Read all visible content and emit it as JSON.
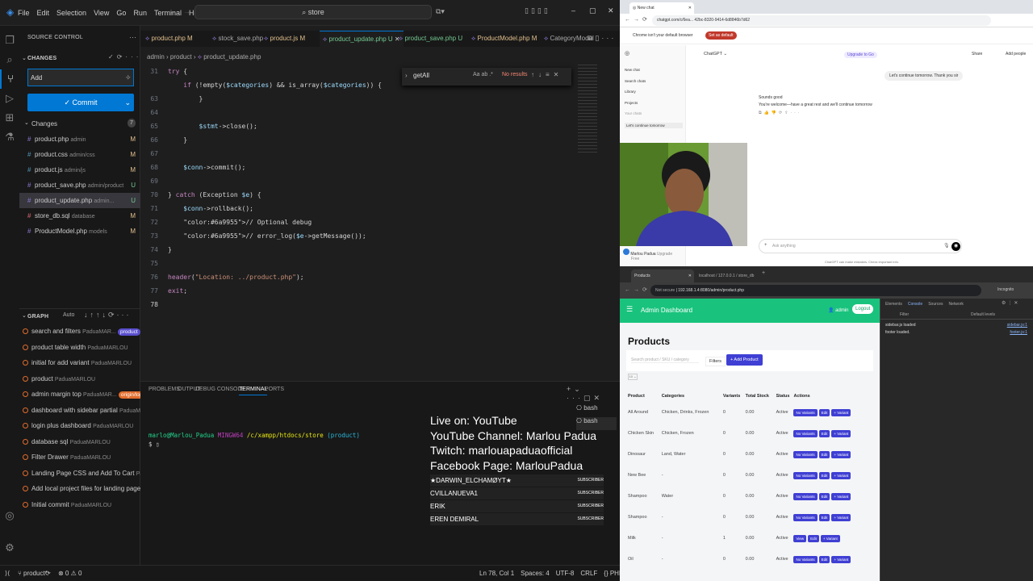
{
  "vscode": {
    "menu": [
      "File",
      "Edit",
      "Selection",
      "View",
      "Go",
      "Run",
      "Terminal",
      "Help"
    ],
    "search_text": "store",
    "source_control_title": "SOURCE CONTROL",
    "changes_header": "CHANGES",
    "commit_input": "Add",
    "commit_button": "✓ Commit",
    "changes_group": "Changes",
    "changes_count": "7",
    "files": [
      {
        "name": "product.php",
        "path": "admin",
        "status": "M"
      },
      {
        "name": "product.css",
        "path": "admin/css",
        "status": "M"
      },
      {
        "name": "product.js",
        "path": "admin/js",
        "status": "M"
      },
      {
        "name": "product_save.php",
        "path": "admin/product",
        "status": "U"
      },
      {
        "name": "product_update.php",
        "path": "admin...",
        "status": "U"
      },
      {
        "name": "store_db.sql",
        "path": "database",
        "status": "M"
      },
      {
        "name": "ProductModel.php",
        "path": "models",
        "status": "M"
      }
    ],
    "graph_header": "GRAPH",
    "graph_auto": "Auto",
    "graph_items": [
      {
        "msg": "search and filters",
        "author": "PaduaMAR...",
        "tag": "product"
      },
      {
        "msg": "product table width",
        "author": "PaduaMARLOU",
        "tag": ""
      },
      {
        "msg": "initial for add variant",
        "author": "PaduaMARLOU",
        "tag": ""
      },
      {
        "msg": "product",
        "author": "PaduaMARLOU",
        "tag": ""
      },
      {
        "msg": "admin margin top",
        "author": "PaduaMAR...",
        "tag": "origin/login"
      },
      {
        "msg": "dashboard with sidebar partial",
        "author": "PaduaMARLOU",
        "tag": ""
      },
      {
        "msg": "login plus dashboard",
        "author": "PaduaMARLOU",
        "tag": ""
      },
      {
        "msg": "database sql",
        "author": "PaduaMARLOU",
        "tag": ""
      },
      {
        "msg": "Filter Drawer",
        "author": "PaduaMARLOU",
        "tag": ""
      },
      {
        "msg": "Landing Page CSS and Add To Cart",
        "author": "PaduaM...",
        "tag": ""
      },
      {
        "msg": "Add local project files for landing page",
        "author": "PaduaM...",
        "tag": ""
      },
      {
        "msg": "Initial commit",
        "author": "PaduaMARLOU",
        "tag": ""
      }
    ],
    "tabs": [
      {
        "name": "product.php",
        "st": "M"
      },
      {
        "name": "stock_save.php",
        "st": ""
      },
      {
        "name": "product.js",
        "st": "M"
      },
      {
        "name": "product_update.php",
        "st": "U"
      },
      {
        "name": "product_save.php",
        "st": "U"
      },
      {
        "name": "ProductModel.php",
        "st": "M"
      },
      {
        "name": "CategoryModel",
        "st": ""
      }
    ],
    "breadcrumb": [
      "admin",
      "product",
      "product_update.php"
    ],
    "find_text": "getAll",
    "find_result": "No results",
    "find_opts": "Aa ab .*",
    "code_lines": [
      {
        "n": "31",
        "t": "try {"
      },
      {
        "n": "",
        "t": "    if (!empty($categories) && is_array($categories)) {"
      },
      {
        "n": "63",
        "t": "        }"
      },
      {
        "n": "64",
        "t": ""
      },
      {
        "n": "65",
        "t": "        $stmt->close();"
      },
      {
        "n": "66",
        "t": "    }"
      },
      {
        "n": "67",
        "t": ""
      },
      {
        "n": "68",
        "t": "    $conn->commit();"
      },
      {
        "n": "69",
        "t": ""
      },
      {
        "n": "70",
        "t": "} catch (Exception $e) {"
      },
      {
        "n": "71",
        "t": "    $conn->rollback();"
      },
      {
        "n": "72",
        "t": "    // Optional debug"
      },
      {
        "n": "73",
        "t": "    // error_log($e->getMessage());"
      },
      {
        "n": "74",
        "t": "}"
      },
      {
        "n": "75",
        "t": ""
      },
      {
        "n": "76",
        "t": "header(\"Location: ../product.php\");"
      },
      {
        "n": "77",
        "t": "exit;"
      },
      {
        "n": "78",
        "t": ""
      }
    ],
    "panel_tabs": [
      "PROBLEMS",
      "OUTPUT",
      "DEBUG CONSOLE",
      "TERMINAL",
      "PORTS"
    ],
    "terminal_prompt_user": "marlo@Marlou_Padua",
    "terminal_prompt_host": "MINGW64",
    "terminal_path": "/c/xampp/htdocs/store",
    "terminal_branch": "(product)",
    "bash_labels": [
      "bash",
      "bash"
    ],
    "status_branch": "product*",
    "status_errors": "⊗ 0 ⚠ 0",
    "status_right": [
      "Ln 78, Col 1",
      "Spaces: 4",
      "UTF-8",
      "CRLF",
      "{} PHP"
    ]
  },
  "overlay": {
    "lines": [
      "Live on: YouTube",
      "YouTube Channel: Marlou Padua",
      "Twitch: marlouapaduaofficial",
      "Facebook Page: MarlouPadua"
    ],
    "subs": [
      "★DARWIN_ELCHAMØYT★",
      "CVILLANUEVA1",
      "ERIK",
      "EREN DEMIRAL"
    ],
    "sub_badge": "SUBSCRIBER"
  },
  "chat": {
    "url": "chatgpt.com/c/6ea... 42bc-8320-9414-6d8846b7d62",
    "banner_text": "Chrome isn't your default browser",
    "banner_btn": "Set as default",
    "model": "ChatGPT",
    "upgrade": "Upgrade to Go",
    "share": "Share",
    "add_people": "Add people",
    "sidebar_items": [
      "New chat",
      "Search chats",
      "Library",
      "Projects",
      "Your chats",
      "Let's continue tomorrow"
    ],
    "user_msg": "Let's continue tomorrow. Thank you sir",
    "bot_line1": "Sounds good",
    "bot_line2": "You're welcome—have a great rest and we'll continue tomorrow",
    "input_ph": "Ask anything",
    "footer": "ChatGPT can make mistakes. Check important info.",
    "user_name": "Marlou Padua",
    "user_plan": "Free",
    "upgrade_small": "Upgrade"
  },
  "admin": {
    "tab1": "Products",
    "tab2": "localhost / 127.0.0.1 / store_db",
    "url": "192.168.1.4:8080/admin/product.php",
    "not_secure": "Not secure",
    "incognito": "Incognito",
    "header_title": "Admin Dashboard",
    "user": "admin",
    "logout": "Logout",
    "page_title": "Products",
    "search_ph": "Search product / SKU / category",
    "filters": "Filters",
    "add_product": "+ Add Product",
    "columns": [
      "Product",
      "Categories",
      "Variants",
      "Total Stock",
      "Status",
      "Actions"
    ],
    "rows": [
      {
        "p": "All Around",
        "c": "Chicken, Drinks, Frozen",
        "v": "0",
        "s": "0.00",
        "st": "Active",
        "a": [
          "No Variants",
          "Edit",
          "+ Variant"
        ]
      },
      {
        "p": "Chicken Skin",
        "c": "Chicken, Frozen",
        "v": "0",
        "s": "0.00",
        "st": "Active",
        "a": [
          "No Variants",
          "Edit",
          "+ Variant"
        ]
      },
      {
        "p": "Dinosaur",
        "c": "Land, Water",
        "v": "0",
        "s": "0.00",
        "st": "Active",
        "a": [
          "No Variants",
          "Edit",
          "+ Variant"
        ]
      },
      {
        "p": "New Bee",
        "c": "-",
        "v": "0",
        "s": "0.00",
        "st": "Active",
        "a": [
          "No Variants",
          "Edit",
          "+ Variant"
        ]
      },
      {
        "p": "Shampoo",
        "c": "Water",
        "v": "0",
        "s": "0.00",
        "st": "Active",
        "a": [
          "No Variants",
          "Edit",
          "+ Variant"
        ]
      },
      {
        "p": "Shampoo",
        "c": "-",
        "v": "0",
        "s": "0.00",
        "st": "Active",
        "a": [
          "No Variants",
          "Edit",
          "+ Variant"
        ]
      },
      {
        "p": "Milk",
        "c": "-",
        "v": "1",
        "s": "0.00",
        "st": "Active",
        "a": [
          "View",
          "Edit",
          "+ Variant"
        ]
      },
      {
        "p": "Oil",
        "c": "-",
        "v": "0",
        "s": "0.00",
        "st": "Active",
        "a": [
          "No Variants",
          "Edit",
          "+ Variant"
        ]
      }
    ],
    "devtools_tabs": [
      "Elements",
      "Console",
      "Sources",
      "Network"
    ],
    "console_lines": [
      "sidebar.js loaded",
      "footer loaded."
    ],
    "console_src": [
      "sidebar.js:1",
      "footer.js:1"
    ],
    "default_levels": "Default levels",
    "filter": "Filter"
  },
  "colors": {
    "accent": "#0078d4",
    "admin_green": "#19c37d",
    "purple_btn": "#3f3fd4",
    "modified": "#e2c08d",
    "untracked": "#73c991"
  }
}
